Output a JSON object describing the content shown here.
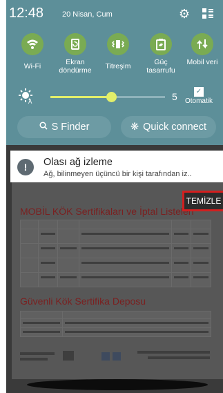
{
  "status_bar": {
    "time": "12:48",
    "date": "20 Nisan, Cum"
  },
  "quick_toggles": [
    {
      "label": "Wi-Fi",
      "icon": "wifi-icon"
    },
    {
      "label": "Ekran döndürme",
      "icon": "screen-rotation-icon"
    },
    {
      "label": "Titreşim",
      "icon": "vibration-icon"
    },
    {
      "label": "Güç tasarrufu",
      "icon": "power-saving-icon"
    },
    {
      "label": "Mobil veri",
      "icon": "mobile-data-icon"
    }
  ],
  "brightness": {
    "value": "5",
    "auto_label": "Otomatik",
    "level": 0.53
  },
  "buttons": {
    "s_finder": "S Finder",
    "quick_connect": "Quick connect"
  },
  "notification": {
    "title": "Olası ağ izleme",
    "body": "Ağ, bilinmeyen üçüncü bir kişi tarafından iz..",
    "action": "TEMİZLE"
  },
  "background_page": {
    "heading_1": "MOBİL KÖK Sertifikaları ve İptal Listeleri",
    "heading_2": "Güvenli Kök Sertifika Deposu"
  },
  "colors": {
    "shade": "#5d8f99",
    "toggle_on": "#7aab53",
    "slider": "#e2ef6a",
    "highlight": "#d21f1f"
  }
}
